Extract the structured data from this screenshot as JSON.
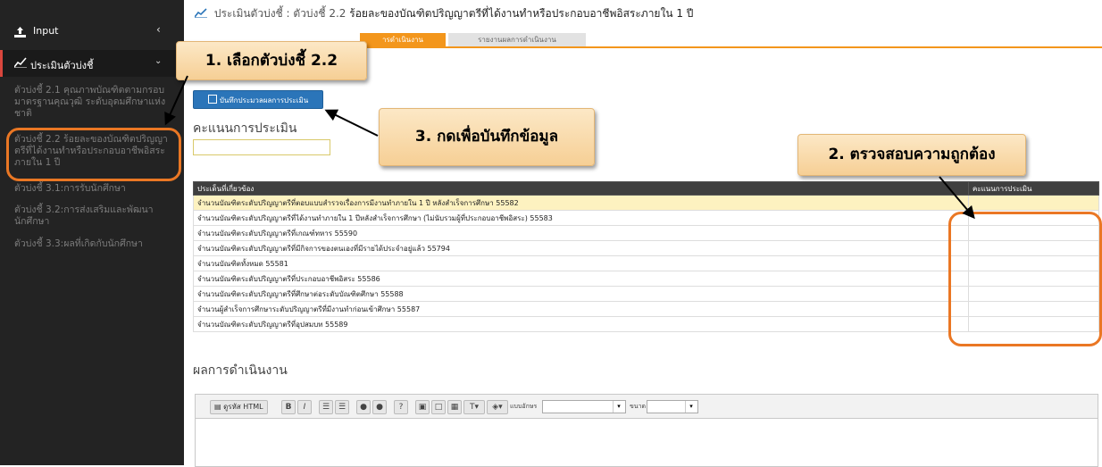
{
  "sidebar": {
    "input_label": "Input",
    "eval_label": "ประเมินตัวบ่งชี้",
    "items": [
      "ตัวบ่งชี้ 2.1 คุณภาพบัณฑิตตามกรอบมาตรฐานคุณวุฒิ ระดับอุดมศึกษาแห่งชาติ",
      "ตัวบ่งชี้ 2.2 ร้อยละของบัณฑิตปริญญาตรีที่ได้งานทำหรือประกอบอาชีพอิสระภายใน 1 ปี",
      "ตัวบ่งชี้ 3.1:การรับนักศึกษา",
      "ตัวบ่งชี้ 3.2:การส่งเสริมและพัฒนานักศึกษา",
      "ตัวบ่งชี้ 3.3:ผลที่เกิดกับนักศึกษา"
    ]
  },
  "header": {
    "title_prefix": "ประเมินตัวบ่งชี้ : ตัวบ่งชี้ 2.2",
    "title_main": "ร้อยละของบัณฑิตปริญญาตรีที่ได้งานทำหรือประกอบอาชีพอิสระภายใน 1 ปี"
  },
  "tabs": [
    {
      "label": "ารดำเนินงาน",
      "active": true
    },
    {
      "label": "รายงานผลการดำเนินงาน",
      "active": false
    }
  ],
  "save_button": "บันทึกประมวลผลการประเมิน",
  "score_heading": "คะแนนการประเมิน",
  "score_value": "",
  "table": {
    "headers": [
      "ประเด็นที่เกี่ยวข้อง",
      "คะแนนการประเมิน"
    ],
    "rows": [
      "จำนวนบัณฑิตระดับปริญญาตรีที่ตอบแบบสำรวจเรื่องการมีงานทำภายใน 1 ปี หลังสำเร็จการศึกษา 55582",
      "จำนวนบัณฑิตระดับปริญญาตรีที่ได้งานทำภายใน 1 ปีหลังสำเร็จการศึกษา (ไม่นับรวมผู้ที่ประกอบอาชีพอิสระ) 55583",
      "จำนวนบัณฑิตระดับปริญญาตรีที่เกณฑ์ทหาร 55590",
      "จำนวนบัณฑิตระดับปริญญาตรีที่มีกิจการของตนเองที่มีรายได้ประจำอยู่แล้ว 55794",
      "จำนวนบัณฑิตทั้งหมด 55581",
      "จำนวนบัณฑิตระดับปริญญาตรีที่ประกอบอาชีพอิสระ 55586",
      "จำนวนบัณฑิตระดับปริญญาตรีที่ศึกษาต่อระดับบัณฑิตศึกษา 55588",
      "จำนวนผู้สำเร็จการศึกษาระดับปริญญาตรีที่มีงานทำก่อนเข้าศึกษา 55587",
      "จำนวนบัณฑิตระดับปริญญาตรีที่อุปสมบท 55589"
    ]
  },
  "results_heading": "ผลการดำเนินงาน",
  "editor": {
    "source_label": "ดูรหัส HTML",
    "bold": "B",
    "italic": "I",
    "font_label": "แบบอักษร",
    "size_label": "ขนาด",
    "font_value": "",
    "size_value": ""
  },
  "callouts": {
    "c1": "1. เลือกตัวบ่งชี้ 2.2",
    "c2": "2. ตรวจสอบความถูกต้อง",
    "c3": "3. กดเพื่อบันทึกข้อมูล"
  },
  "colors": {
    "sidebar_bg": "#232323",
    "accent_orange": "#ea7724",
    "button_blue": "#2b75b9",
    "highlight_row": "#fdf2c0"
  }
}
